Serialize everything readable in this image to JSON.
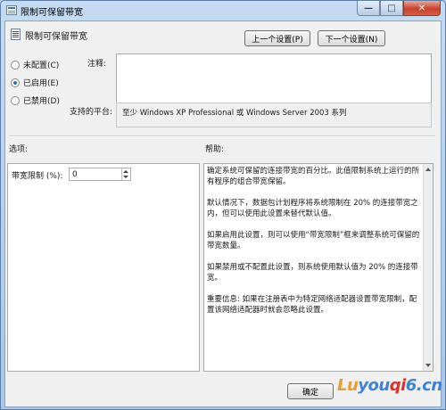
{
  "window": {
    "title": "限制可保留带宽",
    "minimize_glyph": "—",
    "maximize_glyph": "□",
    "close_glyph": "✕"
  },
  "header": {
    "title": "限制可保留带宽",
    "prev_button": "上一个设置(P)",
    "next_button": "下一个设置(N)"
  },
  "state": {
    "options": [
      {
        "label": "未配置(C)",
        "checked": false
      },
      {
        "label": "已启用(E)",
        "checked": true
      },
      {
        "label": "已禁用(D)",
        "checked": false
      }
    ]
  },
  "comment": {
    "label": "注释:",
    "value": ""
  },
  "platform": {
    "label": "支持的平台:",
    "value": "至少 Windows XP Professional 或 Windows Server 2003 系列"
  },
  "options_section": {
    "label": "选项:",
    "bandwidth_label": "带宽限制 (%):",
    "bandwidth_value": "0"
  },
  "help_section": {
    "label": "帮助:",
    "paragraphs": [
      "确定系统可保留的连接带宽的百分比。此值限制系统上运行的所有程序的组合带宽保留。",
      "默认情况下，数据包计划程序将系统限制在 20% 的连接带宽之内，但可以使用此设置来替代默认值。",
      "如果启用此设置，则可以使用“带宽限制”框来调整系统可保留的带宽数量。",
      "如果禁用或不配置此设置，则系统使用默认值为 20% 的连接带宽。",
      "重要信息: 如果在注册表中为特定网络适配器设置带宽限制，配置该网络适配器时就会忽略此设置。"
    ]
  },
  "footer": {
    "ok_button": "确定"
  },
  "watermark": {
    "part1": "Lu",
    "part2": "you",
    "part3": "qi",
    "part4": "6.cn"
  }
}
